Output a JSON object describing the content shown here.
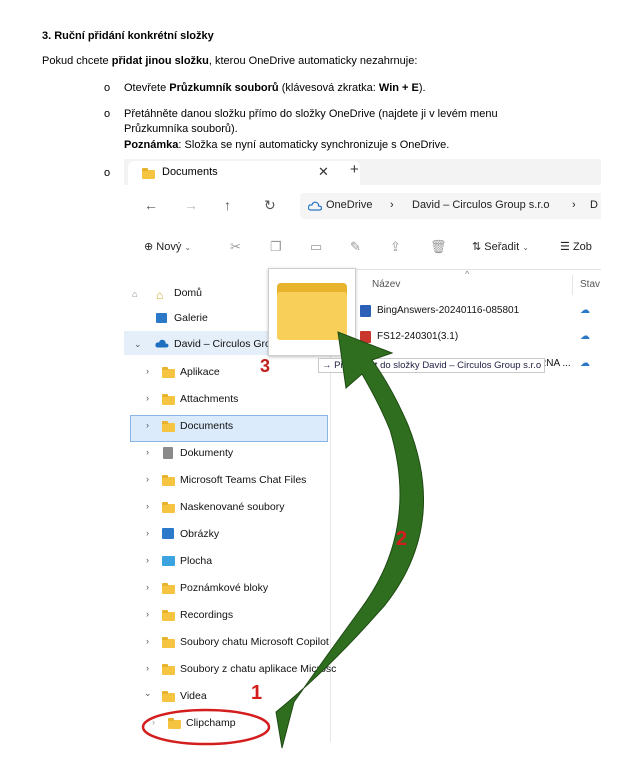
{
  "doc": {
    "heading": "3. Ruční přidání konkrétní složky",
    "intro_before": "Pokud chcete ",
    "intro_bold": "přidat jinou složku",
    "intro_after": ", kterou OneDrive automaticky nezahrnuje:",
    "bullet_char": "o",
    "step1_before": "Otevřete ",
    "step1_bold1": "Průzkumník souborů",
    "step1_mid": " (klávesová zkratka: ",
    "step1_bold2": "Win + E",
    "step1_after": ").",
    "step2_line1": "Přetáhněte danou složku přímo do složky OneDrive (najdete ji v levém menu",
    "step2_line2": "Průzkumníka souborů).",
    "note_label": "Poznámka",
    "note_text": ": Složka se nyní automaticky synchronizuje s OneDrive."
  },
  "explorer": {
    "tab_title": "Documents",
    "tab_close": "✕",
    "tab_add": "+",
    "nav": {
      "back": "←",
      "forward": "→",
      "up": "↑",
      "refresh": "↻"
    },
    "breadcrumb": [
      "OneDrive",
      "›",
      "David – Circulos Group s.r.o",
      "›",
      "D"
    ],
    "toolbar": {
      "new_label": "Nový",
      "sort_label": "Seřadit",
      "view_label": "Zob"
    },
    "sidebar": [
      {
        "label": "Domů"
      },
      {
        "label": "Galerie"
      },
      {
        "label": "David – Circulos Group"
      },
      {
        "label": "Aplikace"
      },
      {
        "label": "Attachments"
      },
      {
        "label": "Documents"
      },
      {
        "label": "Dokumenty"
      },
      {
        "label": "Microsoft Teams Chat Files"
      },
      {
        "label": "Naskenované soubory"
      },
      {
        "label": "Obrázky"
      },
      {
        "label": "Plocha"
      },
      {
        "label": "Poznámkové bloky"
      },
      {
        "label": "Recordings"
      },
      {
        "label": "Soubory chatu Microsoft Copilot"
      },
      {
        "label": "Soubory z chatu aplikace Microsc"
      },
      {
        "label": "Videa"
      },
      {
        "label": "Clipchamp"
      }
    ],
    "columns": {
      "name": "Název",
      "status": "Stav"
    },
    "files": [
      {
        "name": "BingAnswers-20240116-085801"
      },
      {
        "name": "FS12-240301(3.1)"
      },
      {
        "name": "RNA ..."
      }
    ],
    "move_tip_arrow": "→",
    "move_tip_text": "Přesunout do složky David – Circulos Group s.r.o"
  },
  "annotations": {
    "one": "1",
    "two": "2",
    "three": "3",
    "color": "#d41e1e",
    "arrow_color": "#2f6e1f"
  }
}
